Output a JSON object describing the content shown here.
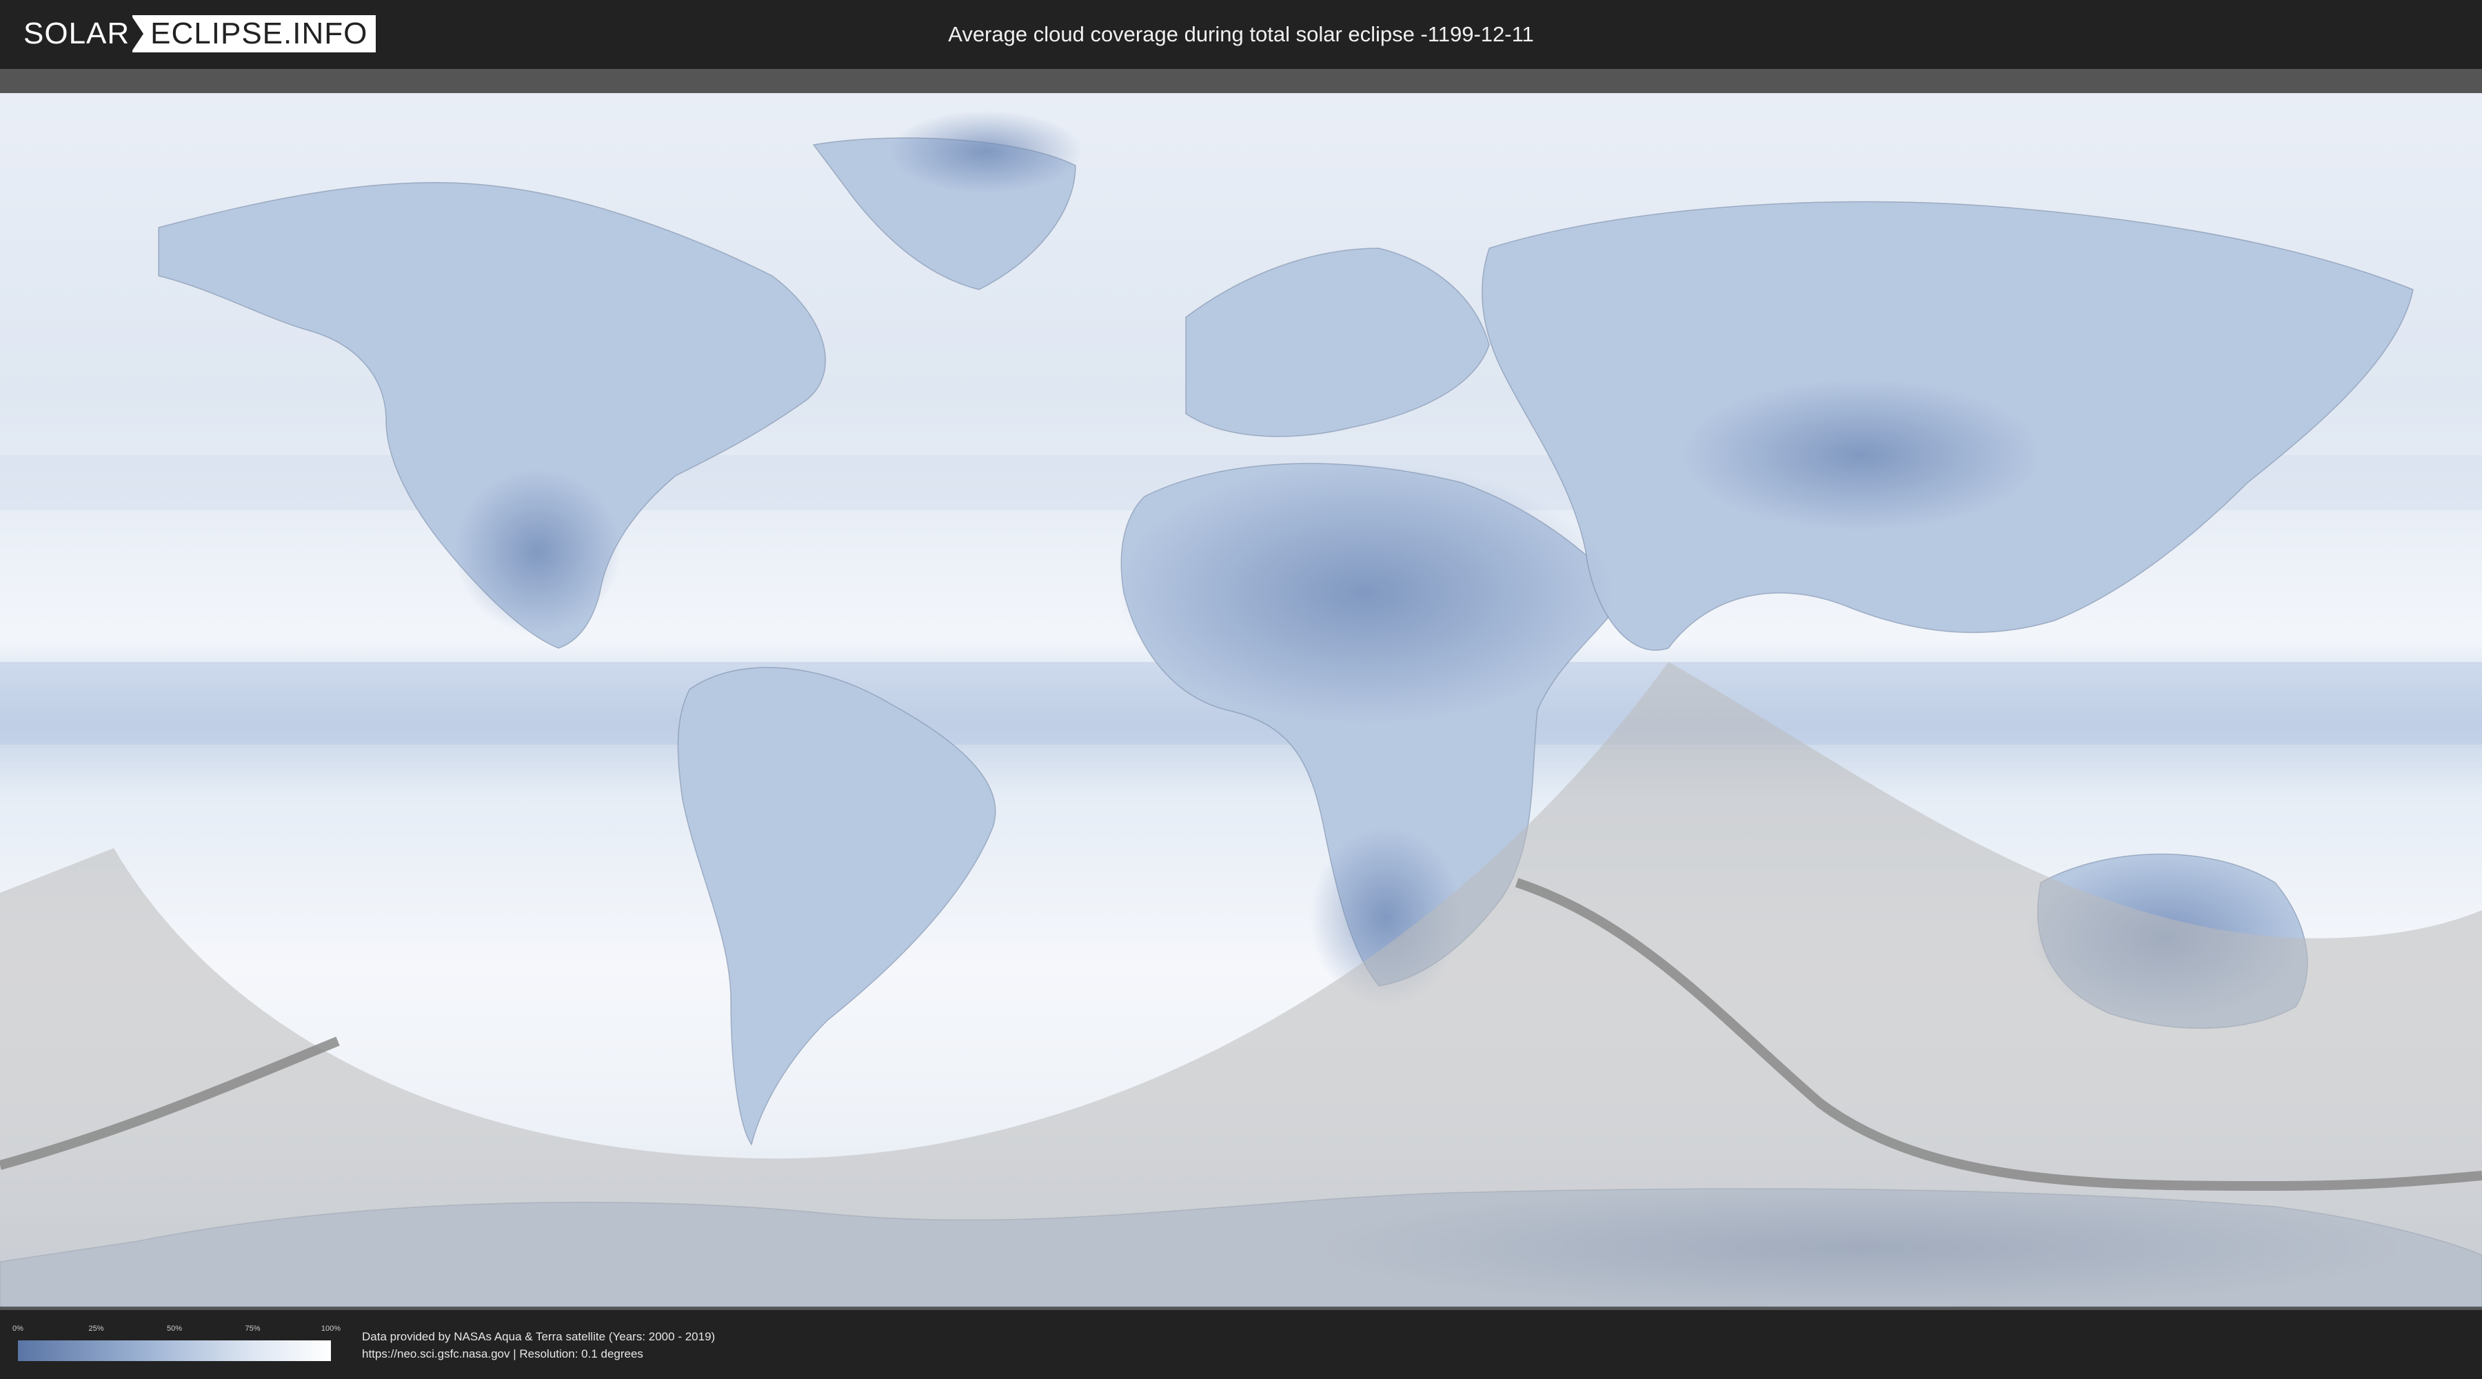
{
  "header": {
    "logo_part1": "SOLAR",
    "logo_part2": "ECLIPSE.INFO",
    "title": "Average cloud coverage during total solar eclipse -1199-12-11"
  },
  "legend": {
    "ticks": [
      "0%",
      "25%",
      "50%",
      "75%",
      "100%"
    ],
    "colors": {
      "low": "#5a75a5",
      "mid": "#9cb2d3",
      "high": "#ffffff"
    }
  },
  "credits": {
    "line1": "Data provided by NASAs Aqua & Terra satellite (Years: 2000 - 2019)",
    "line2": "https://neo.sci.gsfc.nasa.gov | Resolution: 0.1 degrees"
  },
  "map": {
    "projection": "equirectangular",
    "colors": {
      "ocean": "#c8d6ea",
      "land": "#8ea6cc",
      "clear_sky": "#6f89b6",
      "cloudy": "#f4f7fc",
      "night_shade": "#c8c8c8",
      "eclipse_path": "#8a8a8a"
    }
  }
}
